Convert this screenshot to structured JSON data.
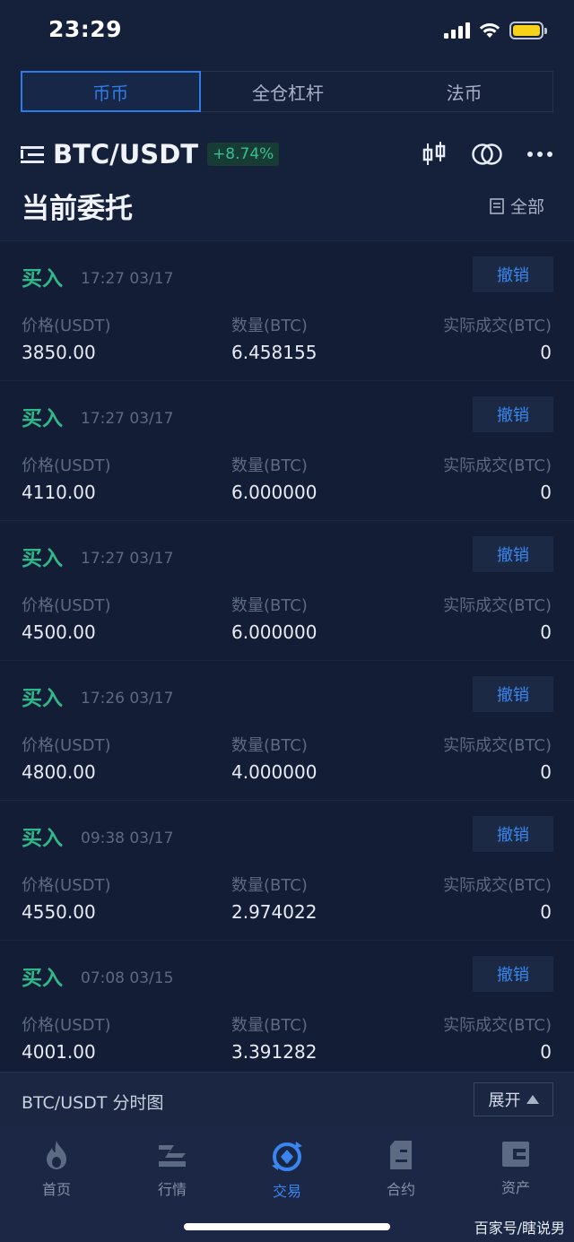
{
  "status_bar": {
    "time": "23:29"
  },
  "segment_tabs": [
    "币币",
    "全仓杠杆",
    "法币"
  ],
  "pair": {
    "name": "BTC/USDT",
    "change": "+8.74%"
  },
  "section": {
    "title": "当前委托",
    "all_label": "全部"
  },
  "column_labels": {
    "price": "价格(USDT)",
    "amount": "数量(BTC)",
    "filled": "实际成交(BTC)"
  },
  "orders": [
    {
      "side": "买入",
      "time": "17:27 03/17",
      "cancel": "撤销",
      "price": "3850.00",
      "amount": "6.458155",
      "filled": "0"
    },
    {
      "side": "买入",
      "time": "17:27 03/17",
      "cancel": "撤销",
      "price": "4110.00",
      "amount": "6.000000",
      "filled": "0"
    },
    {
      "side": "买入",
      "time": "17:27 03/17",
      "cancel": "撤销",
      "price": "4500.00",
      "amount": "6.000000",
      "filled": "0"
    },
    {
      "side": "买入",
      "time": "17:26 03/17",
      "cancel": "撤销",
      "price": "4800.00",
      "amount": "4.000000",
      "filled": "0"
    },
    {
      "side": "买入",
      "time": "09:38 03/17",
      "cancel": "撤销",
      "price": "4550.00",
      "amount": "2.974022",
      "filled": "0"
    },
    {
      "side": "买入",
      "time": "07:08 03/15",
      "cancel": "撤销",
      "price": "4001.00",
      "amount": "3.391282",
      "filled": "0"
    }
  ],
  "chart_bar": {
    "title": "BTC/USDT 分时图",
    "expand": "展开"
  },
  "tabbar": [
    {
      "label": "首页",
      "icon": "flame-icon"
    },
    {
      "label": "行情",
      "icon": "market-icon"
    },
    {
      "label": "交易",
      "icon": "trade-icon"
    },
    {
      "label": "合约",
      "icon": "contract-icon"
    },
    {
      "label": "资产",
      "icon": "wallet-icon"
    }
  ],
  "watermark": "百家号/瞎说男",
  "colors": {
    "accent": "#2f7be8",
    "buy": "#2fb889",
    "background": "#15203a"
  }
}
